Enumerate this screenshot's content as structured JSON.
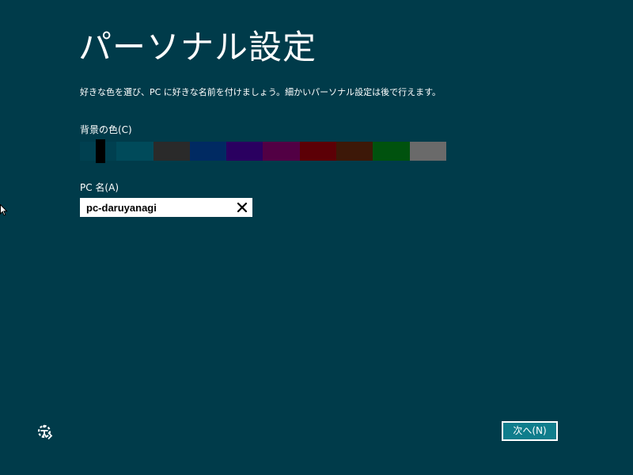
{
  "title": "パーソナル設定",
  "description": "好きな色を選び、PC に好きな名前を付けましょう。細かいパーソナル設定は後で行えます。",
  "colors": {
    "label": "背景の色(C)",
    "swatches": [
      "#004050",
      "#004a5a",
      "#2a2a2a",
      "#002a62",
      "#2a0060",
      "#520044",
      "#5c0006",
      "#3d1808",
      "#00520e",
      "#6a6a6a"
    ],
    "selected_index": 0,
    "slider_color": "#000000"
  },
  "pc_name": {
    "label": "PC 名(A)",
    "value": "pc-daruyanagi"
  },
  "next_button": {
    "label": "次へ(N)"
  },
  "theme": {
    "background": "#003b4a",
    "button_bg": "#0f7d8c"
  },
  "icons": {
    "clear": "close-icon",
    "accessibility": "ease-of-access-icon",
    "pointer": "mouse-pointer-icon"
  }
}
